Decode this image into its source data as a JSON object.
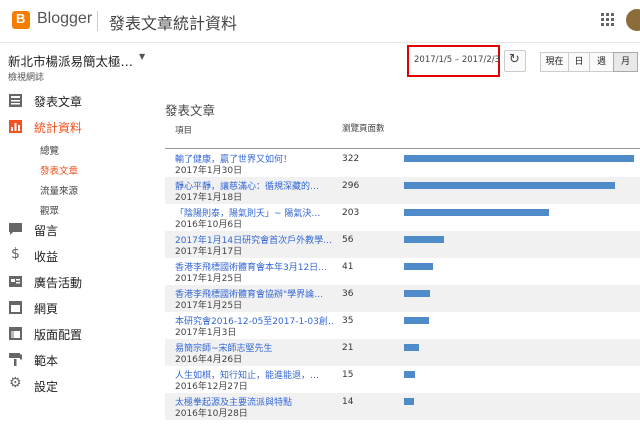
{
  "header": {
    "brand": "Blogger",
    "title": "發表文章統計資料",
    "colors": {
      "brand": "#f57d00",
      "accent": "#f4511e",
      "bar": "#4f8bc9",
      "highlight": "#e00000"
    }
  },
  "sidebar": {
    "blog_name": "新北市楊派易簡太極…",
    "view_blog": "檢視網誌",
    "items": [
      {
        "label": "發表文章",
        "icon": "posts-icon"
      },
      {
        "label": "統計資料",
        "icon": "stats-icon"
      },
      {
        "label": "留言",
        "icon": "comments-icon"
      },
      {
        "label": "收益",
        "icon": "earnings-icon"
      },
      {
        "label": "廣告活動",
        "icon": "campaigns-icon"
      },
      {
        "label": "網頁",
        "icon": "pages-icon"
      },
      {
        "label": "版面配置",
        "icon": "layout-icon"
      },
      {
        "label": "範本",
        "icon": "theme-icon"
      },
      {
        "label": "設定",
        "icon": "settings-icon"
      }
    ],
    "stats_subitems": [
      {
        "label": "總覽"
      },
      {
        "label": "發表文章"
      },
      {
        "label": "流量來源"
      },
      {
        "label": "觀眾"
      }
    ]
  },
  "toolbar": {
    "date_range": "2017/1/5 – 2017/2/3",
    "segments": [
      {
        "label": "現在"
      },
      {
        "label": "日"
      },
      {
        "label": "週"
      },
      {
        "label": "月"
      }
    ]
  },
  "main": {
    "section_title": "發表文章",
    "columns": {
      "item": "項目",
      "views": "瀏覽頁面數"
    },
    "rows": [
      {
        "title": "輸了健康，贏了世界又如何！",
        "date": "2017年1月30日",
        "views": 322
      },
      {
        "title": "靜心平靜，讓慈滿心：循規深藏的…",
        "date": "2017年1月18日",
        "views": 296
      },
      {
        "title": "「陰陽則泰，陽氣則夭」~ 陽氣決…",
        "date": "2016年10月6日",
        "views": 203
      },
      {
        "title": "2017年1月14日研究會首次戶外教學…",
        "date": "2017年1月17日",
        "views": 56
      },
      {
        "title": "香港李飛標國術體育會本年3月12日…",
        "date": "2017年1月25日",
        "views": 41
      },
      {
        "title": "香港李飛標國術體育會協辦\"學界論…",
        "date": "2017年1月25日",
        "views": 36
      },
      {
        "title": "本研究會2016-12-05至2017-1-03創…",
        "date": "2017年1月3日",
        "views": 35
      },
      {
        "title": "易簡宗師~宋師志堅先生",
        "date": "2016年4月26日",
        "views": 21
      },
      {
        "title": "人生如棋，知行知止，能進能退，…",
        "date": "2016年12月27日",
        "views": 15
      },
      {
        "title": "太極拳起源及主要流派與特點",
        "date": "2016年10月28日",
        "views": 14
      }
    ]
  }
}
